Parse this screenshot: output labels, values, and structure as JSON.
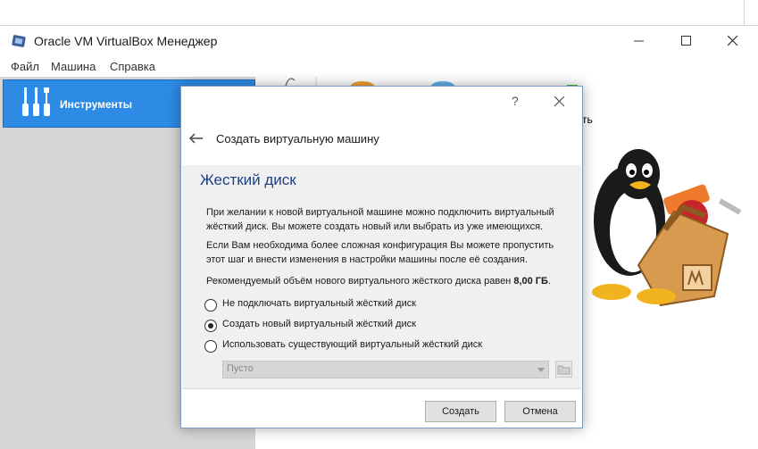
{
  "window": {
    "title": "Oracle VM VirtualBox Менеджер"
  },
  "menu": [
    "Файл",
    "Машина",
    "Справка"
  ],
  "sidebar": {
    "tools_label": "Инструменты"
  },
  "background": {
    "partial_label": "ть"
  },
  "dialog": {
    "help_label": "?",
    "header_title": "Создать виртуальную машину",
    "section_title": "Жесткий диск",
    "paragraph1": "При желании к новой виртуальной машине можно подключить виртуальный жёсткий диск. Вы можете создать новый или выбрать из уже имеющихся.",
    "paragraph2": "Если Вам необходима более сложная конфигурация Вы можете пропустить этот шаг и внести изменения в настройки машины после её создания.",
    "paragraph3_prefix": "Рекомендуемый объём нового виртуального жёсткого диска равен ",
    "recommended_size": "8,00 ГБ",
    "paragraph3_suffix": ".",
    "options": [
      {
        "label": "Не подключать виртуальный жёсткий диск",
        "selected": false
      },
      {
        "label": "Создать новый виртуальный жёсткий диск",
        "selected": true
      },
      {
        "label": "Использовать существующий виртуальный жёсткий диск",
        "selected": false
      }
    ],
    "disk_select_value": "Пусто",
    "buttons": {
      "create": "Создать",
      "cancel": "Отмена"
    }
  },
  "colors": {
    "accent": "#2d8be5",
    "section_title": "#1c3f87"
  }
}
